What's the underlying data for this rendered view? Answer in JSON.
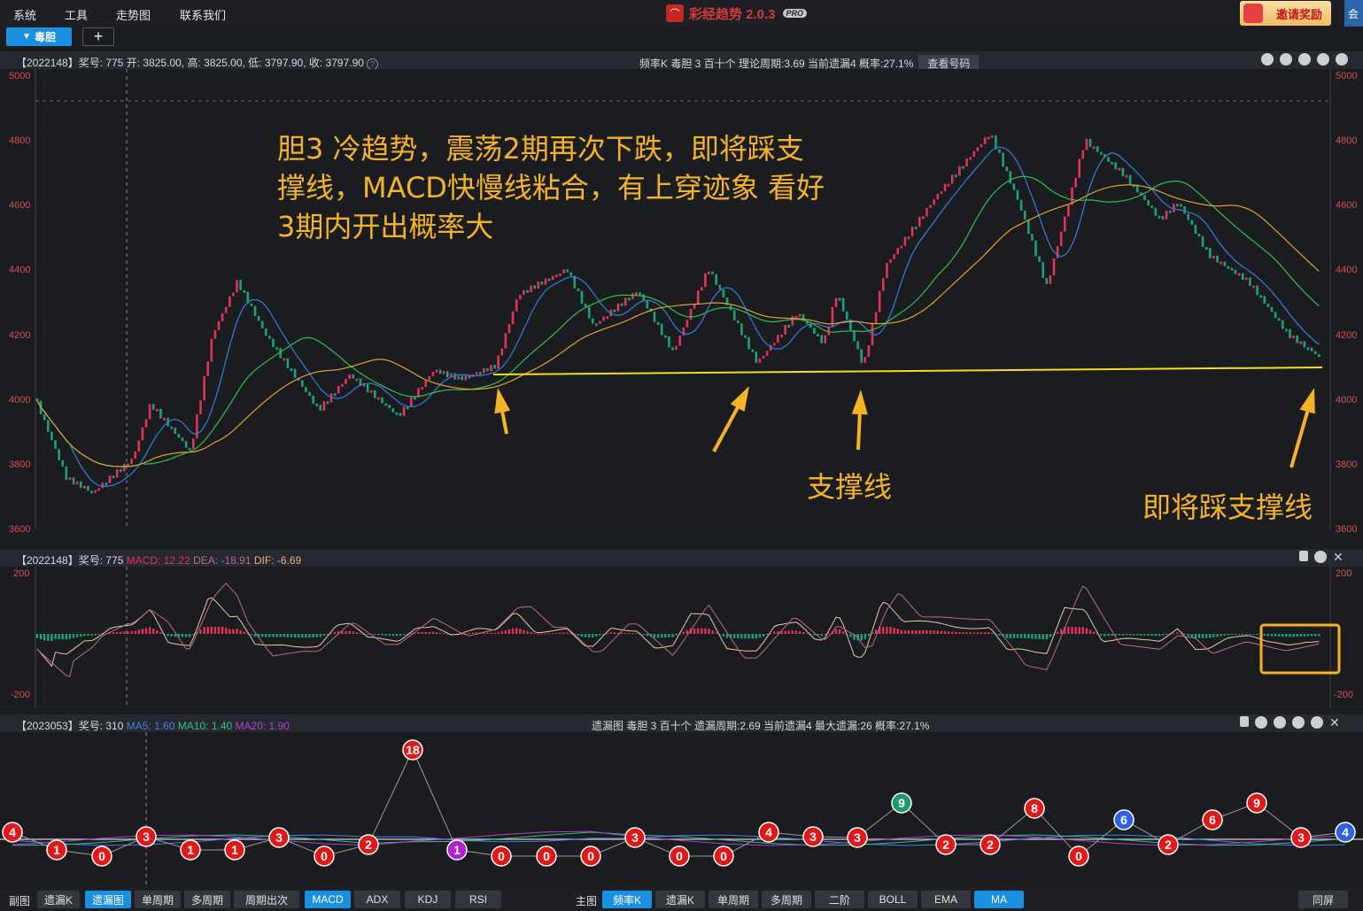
{
  "menu": {
    "system": "系统",
    "tools": "工具",
    "trend_chart": "走势图",
    "contact": "联系我们"
  },
  "app": {
    "title": "彩经趋势 2.0.3",
    "badge": "PRO",
    "invite": "邀请奖励",
    "edge": "会"
  },
  "tabs": {
    "active": "毒胆",
    "add": "+"
  },
  "main_panel": {
    "info": "【2022148】奖号: 775  开: 3825.00, 高: 3825.00, 低: 3797.90, 收: 3797.90",
    "meta": "频率K  毒胆  3  百十个  理论周期:3.69  当前遗漏4  概率:27.1%",
    "button": "查看号码",
    "y_ticks": [
      "5000",
      "4800",
      "4600",
      "4400",
      "4200",
      "4000",
      "3800",
      "3600"
    ],
    "annotation_main": "胆3 冷趋势，震荡2期再次下跌，即将踩支撑线，MACD快慢线粘合，有上穿迹象 看好3期内开出概率大",
    "annotation_support": "支撑线",
    "annotation_step": "即将踩支撑线"
  },
  "macd_panel": {
    "info_prefix": "【2022148】奖号: 775 ",
    "macd": "MACD: 12.22",
    "dea": "DEA: -18.91",
    "dif": "DIF: -6.69",
    "y_top": "200",
    "y_bottom": "-200"
  },
  "miss_panel": {
    "info_prefix": "【2023053】奖号: 310 ",
    "ma5": "MA5: 1.60",
    "ma10": "MA10: 1.40",
    "ma20": "MA20: 1.90",
    "meta": "遗漏图  毒胆  3  百十个  遗漏周期:2.69  当前遗漏4  最大遗漏:26  概率:27.1%",
    "points": [
      {
        "v": "4",
        "c": "red"
      },
      {
        "v": "1",
        "c": "red"
      },
      {
        "v": "0",
        "c": "red"
      },
      {
        "v": "3",
        "c": "red"
      },
      {
        "v": "1",
        "c": "red"
      },
      {
        "v": "1",
        "c": "red"
      },
      {
        "v": "3",
        "c": "red"
      },
      {
        "v": "0",
        "c": "red"
      },
      {
        "v": "2",
        "c": "red"
      },
      {
        "v": "18",
        "c": "red"
      },
      {
        "v": "1",
        "c": "purple"
      },
      {
        "v": "0",
        "c": "red"
      },
      {
        "v": "0",
        "c": "red"
      },
      {
        "v": "0",
        "c": "red"
      },
      {
        "v": "3",
        "c": "red"
      },
      {
        "v": "0",
        "c": "red"
      },
      {
        "v": "0",
        "c": "red"
      },
      {
        "v": "4",
        "c": "red"
      },
      {
        "v": "3",
        "c": "red"
      },
      {
        "v": "3",
        "c": "red"
      },
      {
        "v": "9",
        "c": "green"
      },
      {
        "v": "2",
        "c": "red"
      },
      {
        "v": "2",
        "c": "red"
      },
      {
        "v": "8",
        "c": "red"
      },
      {
        "v": "0",
        "c": "red"
      },
      {
        "v": "6",
        "c": "blue"
      },
      {
        "v": "2",
        "c": "red"
      },
      {
        "v": "6",
        "c": "red"
      },
      {
        "v": "9",
        "c": "red"
      },
      {
        "v": "3",
        "c": "red"
      },
      {
        "v": "4",
        "c": "blue"
      }
    ]
  },
  "bottom": {
    "sub_label": "副图",
    "sub_buttons": [
      "遗漏K",
      "遗漏图",
      "单周期",
      "多周期",
      "周期出次",
      "MACD",
      "ADX",
      "KDJ",
      "RSI"
    ],
    "main_label": "主图",
    "main_buttons": [
      "频率K",
      "遗漏K",
      "单周期",
      "多周期",
      "二阶",
      "BOLL",
      "EMA",
      "MA"
    ],
    "fullscreen": "同屏"
  },
  "colors": {
    "up": "#e0325a",
    "down": "#1aa37a",
    "ma_blue": "#2f7fe0",
    "ma_green": "#2fbf4f",
    "ma_orange": "#e0a030",
    "support": "#f0e020",
    "annot": "#f4b325"
  }
}
